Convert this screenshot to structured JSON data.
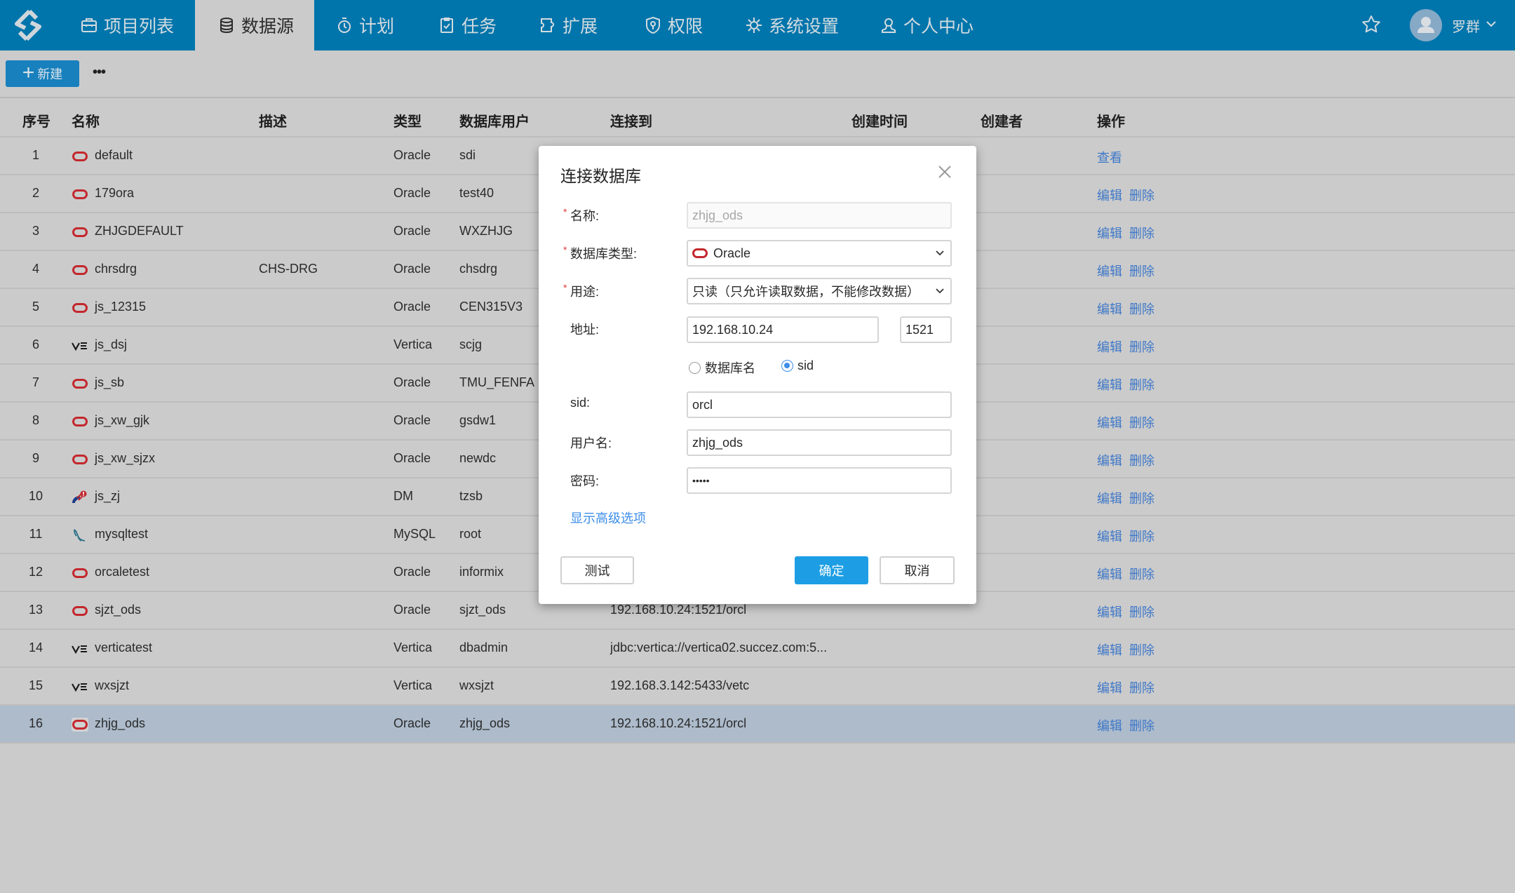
{
  "nav": {
    "logo": "app-logo",
    "tabs": [
      {
        "label": "项目列表",
        "icon": "briefcase-icon",
        "active": false
      },
      {
        "label": "数据源",
        "icon": "database-icon",
        "active": true
      },
      {
        "label": "计划",
        "icon": "timer-icon",
        "active": false
      },
      {
        "label": "任务",
        "icon": "clipboard-check-icon",
        "active": false
      },
      {
        "label": "扩展",
        "icon": "puzzle-icon",
        "active": false
      },
      {
        "label": "权限",
        "icon": "shield-key-icon",
        "active": false
      },
      {
        "label": "系统设置",
        "icon": "gear-icon",
        "active": false
      },
      {
        "label": "个人中心",
        "icon": "user-icon",
        "active": false
      }
    ],
    "user_name": "罗群"
  },
  "toolbar": {
    "new_label": "新建",
    "more_label": "•••"
  },
  "table": {
    "headers": [
      "序号",
      "名称",
      "描述",
      "类型",
      "数据库用户",
      "连接到",
      "创建时间",
      "创建者",
      "操作"
    ],
    "rows": [
      {
        "idx": "1",
        "icon": "oracle",
        "name": "default",
        "desc": "",
        "type": "Oracle",
        "user": "sdi",
        "conn": "",
        "ops": [
          "查看"
        ]
      },
      {
        "idx": "2",
        "icon": "oracle",
        "name": "179ora",
        "desc": "",
        "type": "Oracle",
        "user": "test40",
        "conn": "",
        "ops": [
          "编辑",
          "删除"
        ]
      },
      {
        "idx": "3",
        "icon": "oracle",
        "name": "ZHJGDEFAULT",
        "desc": "",
        "type": "Oracle",
        "user": "WXZHJG",
        "conn": "",
        "ops": [
          "编辑",
          "删除"
        ]
      },
      {
        "idx": "4",
        "icon": "oracle",
        "name": "chrsdrg",
        "desc": "CHS-DRG",
        "type": "Oracle",
        "user": "chsdrg",
        "conn": "",
        "ops": [
          "编辑",
          "删除"
        ]
      },
      {
        "idx": "5",
        "icon": "oracle",
        "name": "js_12315",
        "desc": "",
        "type": "Oracle",
        "user": "CEN315V3",
        "conn": "",
        "ops": [
          "编辑",
          "删除"
        ]
      },
      {
        "idx": "6",
        "icon": "vertica",
        "name": "js_dsj",
        "desc": "",
        "type": "Vertica",
        "user": "scjg",
        "conn": "",
        "ops": [
          "编辑",
          "删除"
        ]
      },
      {
        "idx": "7",
        "icon": "oracle",
        "name": "js_sb",
        "desc": "",
        "type": "Oracle",
        "user": "TMU_FENFA",
        "conn": "",
        "ops": [
          "编辑",
          "删除"
        ]
      },
      {
        "idx": "8",
        "icon": "oracle",
        "name": "js_xw_gjk",
        "desc": "",
        "type": "Oracle",
        "user": "gsdw1",
        "conn": "",
        "ops": [
          "编辑",
          "删除"
        ]
      },
      {
        "idx": "9",
        "icon": "oracle",
        "name": "js_xw_sjzx",
        "desc": "",
        "type": "Oracle",
        "user": "newdc",
        "conn": "",
        "ops": [
          "编辑",
          "删除"
        ]
      },
      {
        "idx": "10",
        "icon": "dm",
        "name": "js_zj",
        "desc": "",
        "type": "DM",
        "user": "tzsb",
        "conn": "",
        "ops": [
          "编辑",
          "删除"
        ]
      },
      {
        "idx": "11",
        "icon": "mysql",
        "name": "mysqltest",
        "desc": "",
        "type": "MySQL",
        "user": "root",
        "conn": "",
        "ops": [
          "编辑",
          "删除"
        ]
      },
      {
        "idx": "12",
        "icon": "oracle",
        "name": "orcaletest",
        "desc": "",
        "type": "Oracle",
        "user": "informix",
        "conn": "",
        "ops": [
          "编辑",
          "删除"
        ]
      },
      {
        "idx": "13",
        "icon": "oracle",
        "name": "sjzt_ods",
        "desc": "",
        "type": "Oracle",
        "user": "sjzt_ods",
        "conn": "192.168.10.24:1521/orcl",
        "ops": [
          "编辑",
          "删除"
        ]
      },
      {
        "idx": "14",
        "icon": "vertica",
        "name": "verticatest",
        "desc": "",
        "type": "Vertica",
        "user": "dbadmin",
        "conn": "jdbc:vertica://vertica02.succez.com:5...",
        "ops": [
          "编辑",
          "删除"
        ]
      },
      {
        "idx": "15",
        "icon": "vertica",
        "name": "wxsjzt",
        "desc": "",
        "type": "Vertica",
        "user": "wxsjzt",
        "conn": "192.168.3.142:5433/vetc",
        "ops": [
          "编辑",
          "删除"
        ]
      },
      {
        "idx": "16",
        "icon": "oracle",
        "name": "zhjg_ods",
        "desc": "",
        "type": "Oracle",
        "user": "zhjg_ods",
        "conn": "192.168.10.24:1521/orcl",
        "ops": [
          "编辑",
          "删除"
        ],
        "selected": true
      }
    ]
  },
  "dialog": {
    "title": "连接数据库",
    "fields": {
      "name": {
        "label": "名称:",
        "value": "zhjg_ods",
        "required": true
      },
      "db_type": {
        "label": "数据库类型:",
        "value": "Oracle",
        "required": true
      },
      "usage": {
        "label": "用途:",
        "value": "只读（只允许读取数据，不能修改数据）",
        "required": true
      },
      "address": {
        "label": "地址:",
        "host": "192.168.10.24",
        "port": "1521"
      },
      "mode": {
        "options": [
          "数据库名",
          "sid"
        ],
        "selected": "sid"
      },
      "sid": {
        "label": "sid:",
        "value": "orcl"
      },
      "username": {
        "label": "用户名:",
        "value": "zhjg_ods"
      },
      "password": {
        "label": "密码:",
        "value": "•••••"
      }
    },
    "advanced_link": "显示高级选项",
    "buttons": {
      "test": "测试",
      "ok": "确定",
      "cancel": "取消"
    }
  },
  "colors": {
    "nav_bg": "#0075ab",
    "overlay_bg": "#cbcbcb",
    "selected_row": "#adbbcb",
    "link": "#3f78c8",
    "primary": "#1d9ee4",
    "oracle_red": "#c3282d"
  }
}
